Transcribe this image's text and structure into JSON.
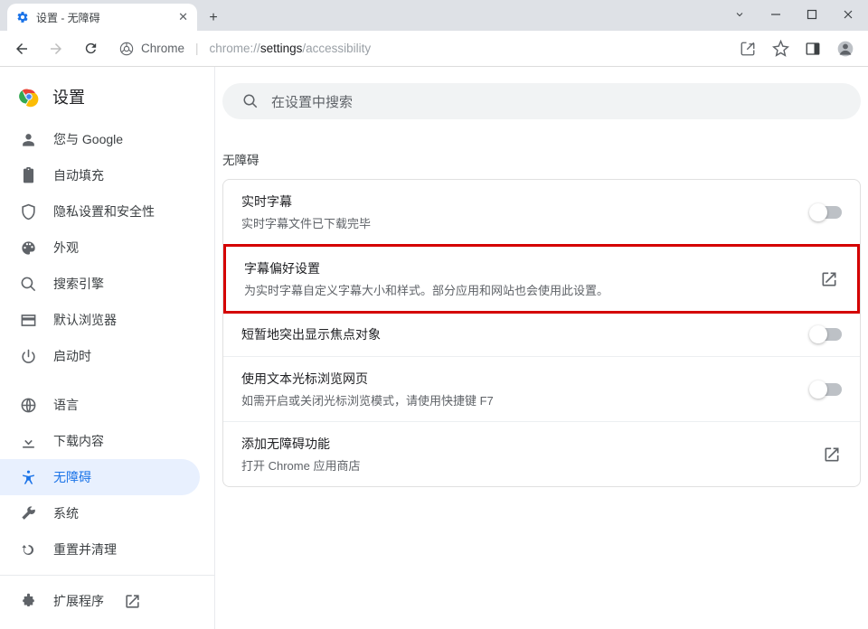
{
  "tab": {
    "title": "设置 - 无障碍"
  },
  "omnibox": {
    "scheme": "Chrome",
    "url_prefix": "chrome://",
    "url_mid": "settings",
    "url_suffix": "/accessibility"
  },
  "settings_header": "设置",
  "nav": [
    {
      "key": "you",
      "label": "您与 Google"
    },
    {
      "key": "autofill",
      "label": "自动填充"
    },
    {
      "key": "privacy",
      "label": "隐私设置和安全性"
    },
    {
      "key": "appearance",
      "label": "外观"
    },
    {
      "key": "search",
      "label": "搜索引擎"
    },
    {
      "key": "browser",
      "label": "默认浏览器"
    },
    {
      "key": "startup",
      "label": "启动时"
    },
    {
      "key": "languages",
      "label": "语言"
    },
    {
      "key": "downloads",
      "label": "下载内容"
    },
    {
      "key": "a11y",
      "label": "无障碍"
    },
    {
      "key": "system",
      "label": "系统"
    },
    {
      "key": "reset",
      "label": "重置并清理"
    },
    {
      "key": "extensions",
      "label": "扩展程序"
    }
  ],
  "search_placeholder": "在设置中搜索",
  "section_title": "无障碍",
  "rows": [
    {
      "title": "实时字幕",
      "sub": "实时字幕文件已下载完毕",
      "control": "toggle",
      "on": false
    },
    {
      "title": "字幕偏好设置",
      "sub": "为实时字幕自定义字幕大小和样式。部分应用和网站也会使用此设置。",
      "control": "launch",
      "highlight": true
    },
    {
      "title": "短暂地突出显示焦点对象",
      "sub": "",
      "control": "toggle",
      "on": false
    },
    {
      "title": "使用文本光标浏览网页",
      "sub": "如需开启或关闭光标浏览模式，请使用快捷键 F7",
      "control": "toggle",
      "on": false
    },
    {
      "title": "添加无障碍功能",
      "sub": "打开 Chrome 应用商店",
      "control": "launch"
    }
  ]
}
